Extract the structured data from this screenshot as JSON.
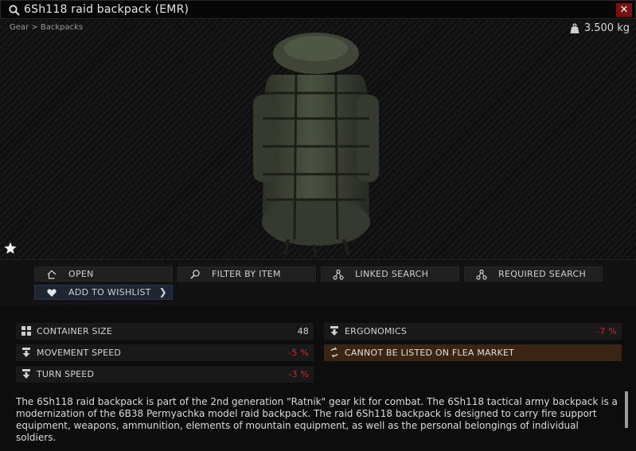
{
  "window": {
    "title": "6Sh118 raid backpack (EMR)",
    "close_label": "✕"
  },
  "preview": {
    "breadcrumb": "Gear > Backpacks",
    "weight": "3.500 kg"
  },
  "actions": {
    "open": "OPEN",
    "filter_by_item": "FILTER BY ITEM",
    "linked_search": "LINKED SEARCH",
    "required_search": "REQUIRED SEARCH",
    "add_to_wishlist": "ADD TO WISHLIST"
  },
  "stats": {
    "container_size": {
      "label": "CONTAINER SIZE",
      "value": "48"
    },
    "ergonomics": {
      "label": "ERGONOMICS",
      "value": "-7 %"
    },
    "movement_speed": {
      "label": "MOVEMENT SPEED",
      "value": "-5 %"
    },
    "flea": {
      "label": "CANNOT BE LISTED ON FLEA MARKET"
    },
    "turn_speed": {
      "label": "TURN SPEED",
      "value": "-3 %"
    }
  },
  "description": "The 6Sh118 raid backpack is part of the 2nd generation \"Ratnik\" gear kit for combat. The 6Sh118 tactical army backpack is a modernization of the 6B38 Permyachka model raid backpack. The raid 6Sh118 backpack is designed to carry fire support equipment, weapons, ammunition, elements of mountain equipment, as well as the personal belongings of individual soldiers.",
  "colors": {
    "negative": "#c42a2a",
    "close": "#7a1111",
    "flea_bg": "#3a2413",
    "wishlist_bg": "#1d2631"
  }
}
